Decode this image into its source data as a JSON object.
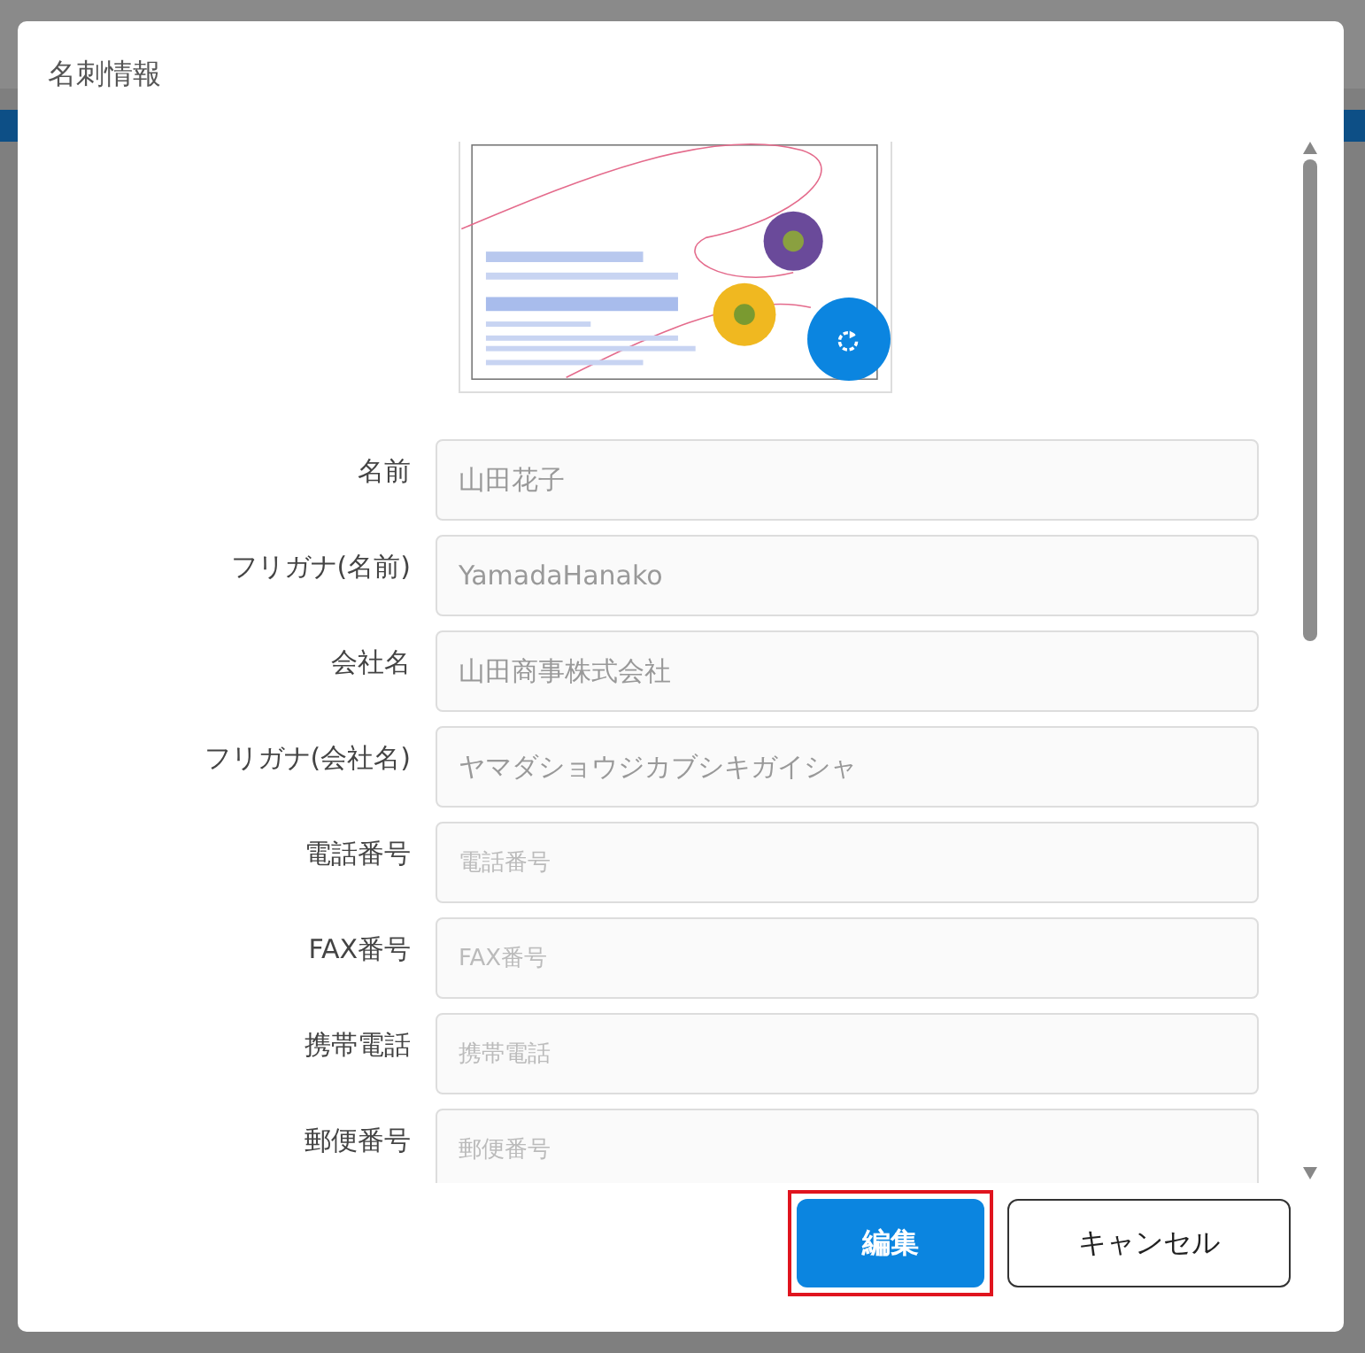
{
  "dialog": {
    "title": "名刺情報",
    "fields": [
      {
        "label": "名前",
        "value": "山田花子"
      },
      {
        "label": "フリガナ(名前)",
        "value": "YamadaHanako"
      },
      {
        "label": "会社名",
        "value": "山田商事株式会社"
      },
      {
        "label": "フリガナ(会社名)",
        "value": "ヤマダショウジカブシキガイシャ"
      },
      {
        "label": "電話番号",
        "placeholder": "電話番号"
      },
      {
        "label": "FAX番号",
        "placeholder": "FAX番号"
      },
      {
        "label": "携帯電話",
        "placeholder": "携帯電話"
      },
      {
        "label": "郵便番号",
        "placeholder": "郵便番号"
      }
    ],
    "buttons": [
      {
        "label": "編集",
        "kind": "primary",
        "highlighted": true
      },
      {
        "label": "キャンセル",
        "kind": "secondary",
        "highlighted": false
      }
    ]
  }
}
